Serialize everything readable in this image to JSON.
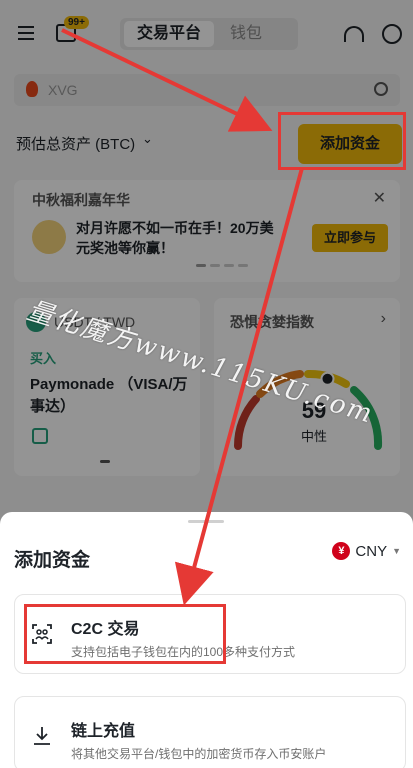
{
  "topbar": {
    "badge": "99+",
    "tab_exchange": "交易平台",
    "tab_wallet": "钱包"
  },
  "search": {
    "text": "XVG"
  },
  "assets": {
    "label": "预估总资产 (BTC)",
    "chevron": "⌄",
    "add_funds_label": "添加资金"
  },
  "promo": {
    "title": "中秋福利嘉年华",
    "text": "对月许愿不如一币在手！20万美元奖池等你赢！",
    "button": "立即参与",
    "close": "✕"
  },
  "p2p_card": {
    "pair": "USDT / TWD",
    "tag": "买入",
    "merchant": "Paymonade （VISA/万事达）"
  },
  "fear_greed": {
    "title": "恐惧贪婪指数",
    "chevron": "›",
    "value": "59",
    "label": "中性",
    "level": 0.59
  },
  "sheet": {
    "title": "添加资金",
    "currency": "CNY",
    "currency_symbol": "¥",
    "options": [
      {
        "title": "C2C 交易",
        "desc": "支持包括电子钱包在内的100多种支付方式",
        "icon": "c2c-scan-icon"
      },
      {
        "title": "链上充值",
        "desc": "将其他交易平台/钱包中的加密货币存入币安账户",
        "icon": "download-icon"
      }
    ]
  },
  "watermark": "量化魔方www.115KU.com",
  "colors": {
    "accent": "#f0b90b",
    "annotation": "#e53935",
    "buy": "#27a17c"
  }
}
